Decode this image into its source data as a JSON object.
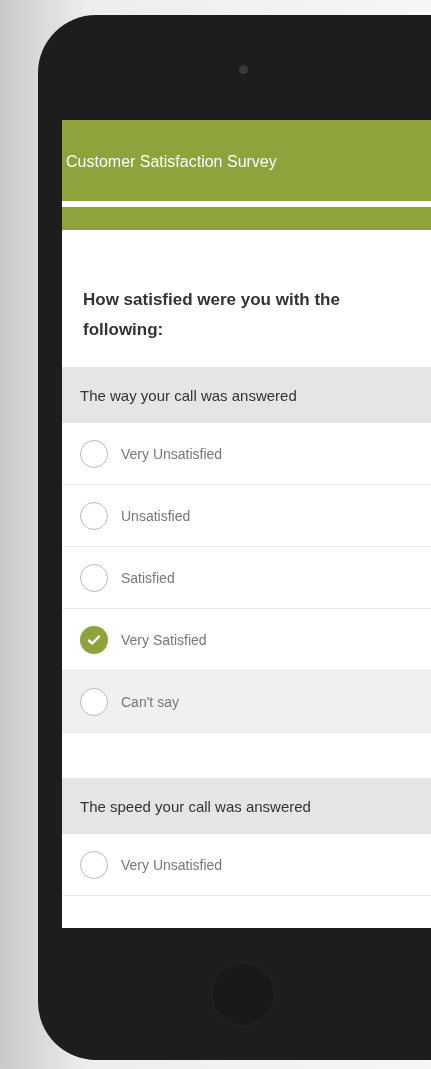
{
  "header": {
    "title": "Customer Satisfaction Survey",
    "progress": {
      "level": 1
    }
  },
  "question": "How satisfied were you with the following:",
  "sections": [
    {
      "heading": "The way your call was answered",
      "options": [
        {
          "label": "Very Unsatisfied",
          "selected": false,
          "highlighted": false
        },
        {
          "label": "Unsatisfied",
          "selected": false,
          "highlighted": false
        },
        {
          "label": "Satisfied",
          "selected": false,
          "highlighted": false
        },
        {
          "label": "Very Satisfied",
          "selected": true,
          "highlighted": false
        },
        {
          "label": "Can't say",
          "selected": false,
          "highlighted": true
        }
      ]
    },
    {
      "heading": "The speed your call was answered",
      "options": [
        {
          "label": "Very Unsatisfied",
          "selected": false,
          "highlighted": false
        }
      ]
    }
  ]
}
